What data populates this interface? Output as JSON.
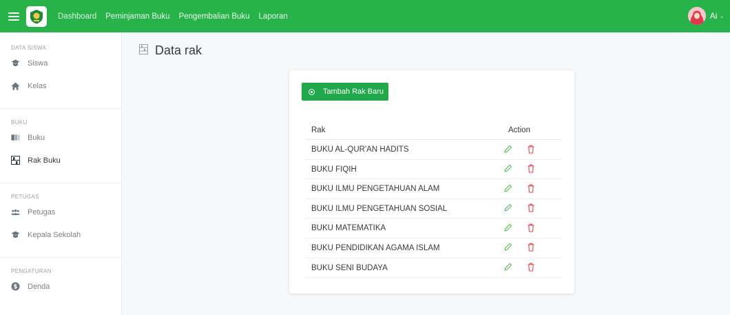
{
  "topbar": {
    "nav": [
      {
        "label": "Dashboard",
        "color": "#d7f2dd"
      },
      {
        "label": "Peminjaman Buku",
        "color": "#e8f7eb"
      },
      {
        "label": "Pengembalian Buku",
        "color": "#e8f7eb"
      },
      {
        "label": "Laporan",
        "color": "#e8f7eb"
      }
    ],
    "user_name": "Ai",
    "user_caret": "⌄"
  },
  "sidebar": {
    "sections": [
      {
        "title": "DATA SISWA",
        "items": [
          {
            "label": "Siswa",
            "icon": "graduation-cap-icon"
          },
          {
            "label": "Kelas",
            "icon": "home-icon"
          }
        ]
      },
      {
        "title": "BUKU",
        "items": [
          {
            "label": "Buku",
            "icon": "book-icon"
          },
          {
            "label": "Rak Buku",
            "icon": "bookshelf-icon",
            "active": true
          }
        ]
      },
      {
        "title": "PETUGAS",
        "items": [
          {
            "label": "Petugas",
            "icon": "users-icon"
          },
          {
            "label": "Kepala Sekolah",
            "icon": "graduation-cap-icon"
          }
        ]
      },
      {
        "title": "PENGATURAN",
        "items": [
          {
            "label": "Denda",
            "icon": "dollar-circle-icon"
          }
        ]
      }
    ]
  },
  "page": {
    "title": "Data rak",
    "title_icon": "bookshelf-icon"
  },
  "card": {
    "add_button": "Tambah Rak Baru",
    "columns": {
      "rak": "Rak",
      "action": "Action"
    },
    "rows": [
      "BUKU AL-QUR'AN HADITS",
      "BUKU FIQIH",
      "BUKU ILMU PENGETAHUAN ALAM",
      "BUKU ILMU PENGETAHUAN SOSIAL",
      "BUKU MATEMATIKA",
      "BUKU PENDIDIKAN AGAMA ISLAM",
      "BUKU SENI BUDAYA"
    ],
    "edit_icon": "pencil-icon",
    "delete_icon": "trash-icon"
  },
  "colors": {
    "brand": "#27b24a",
    "button": "#20a84a",
    "edit": "#5fb85c",
    "delete": "#e0444b"
  }
}
